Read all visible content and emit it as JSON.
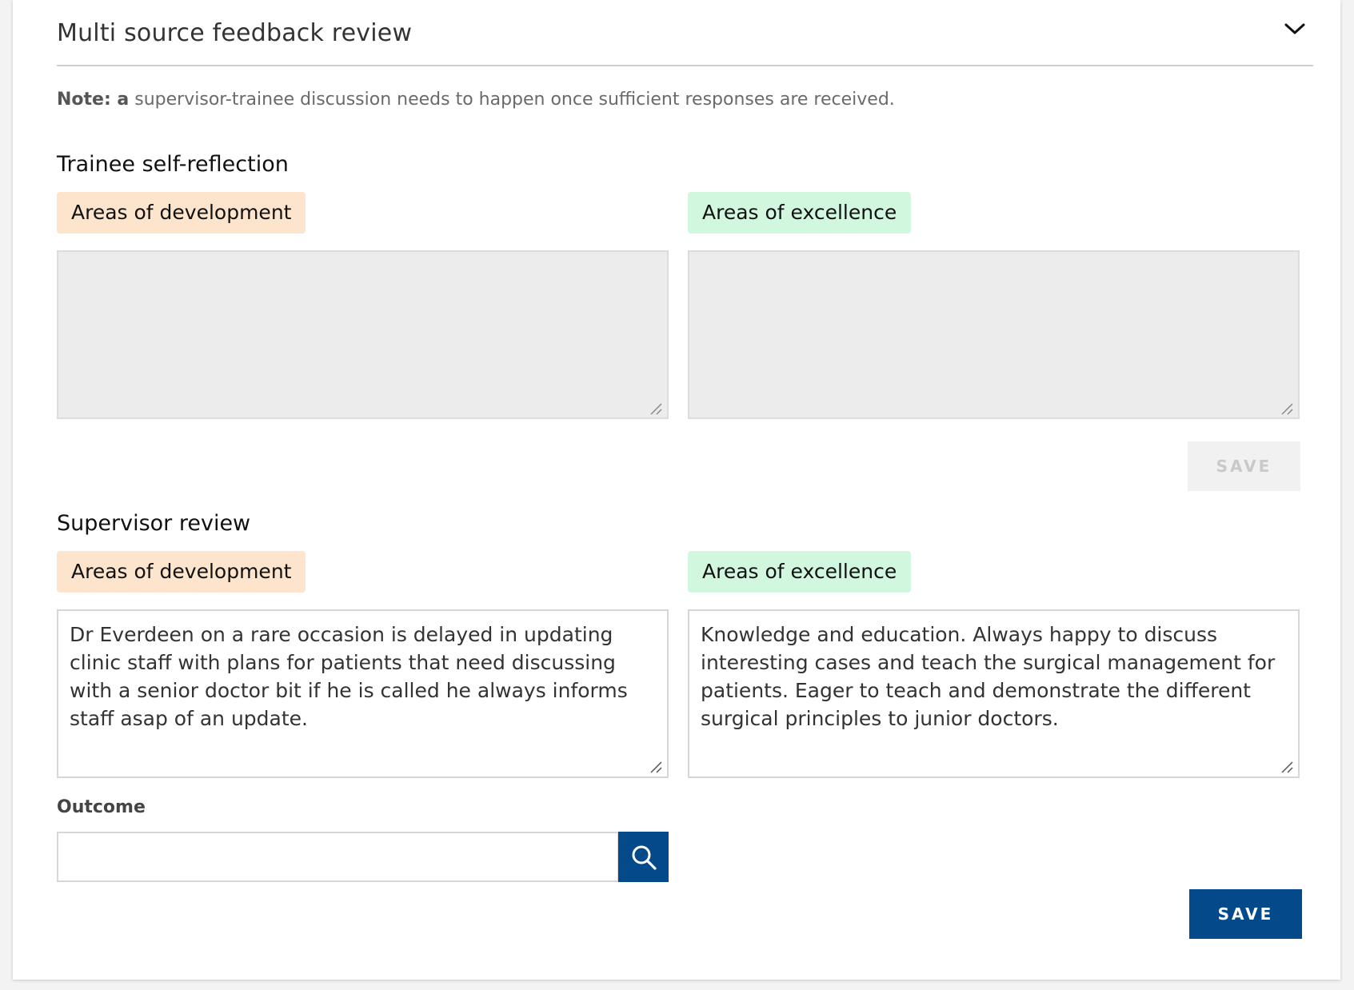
{
  "section": {
    "title": "Multi source feedback review",
    "toggle_icon": "chevron-down-icon"
  },
  "note": {
    "prefix": "Note: a",
    "text": " supervisor-trainee discussion needs to happen once sufficient responses are received."
  },
  "trainee": {
    "title": "Trainee self-reflection",
    "development_label": "Areas of development",
    "excellence_label": "Areas of excellence",
    "development_value": "",
    "excellence_value": "",
    "save_label": "SAVE"
  },
  "supervisor": {
    "title": "Supervisor review",
    "development_label": "Areas of development",
    "excellence_label": "Areas of excellence",
    "development_value": "Dr Everdeen on a rare occasion is delayed in updating clinic staff with plans for patients that need discussing with a senior doctor bit if he is called he always informs staff asap of an update.",
    "excellence_value": "Knowledge and education. Always happy to discuss interesting cases and teach the surgical management for patients. Eager to teach and demonstrate the different surgical principles to junior doctors.",
    "outcome_label": "Outcome",
    "outcome_value": "",
    "save_label": "SAVE"
  },
  "colors": {
    "primary": "#044a8a",
    "development_bg": "#fde4cc",
    "excellence_bg": "#d1f7de"
  }
}
